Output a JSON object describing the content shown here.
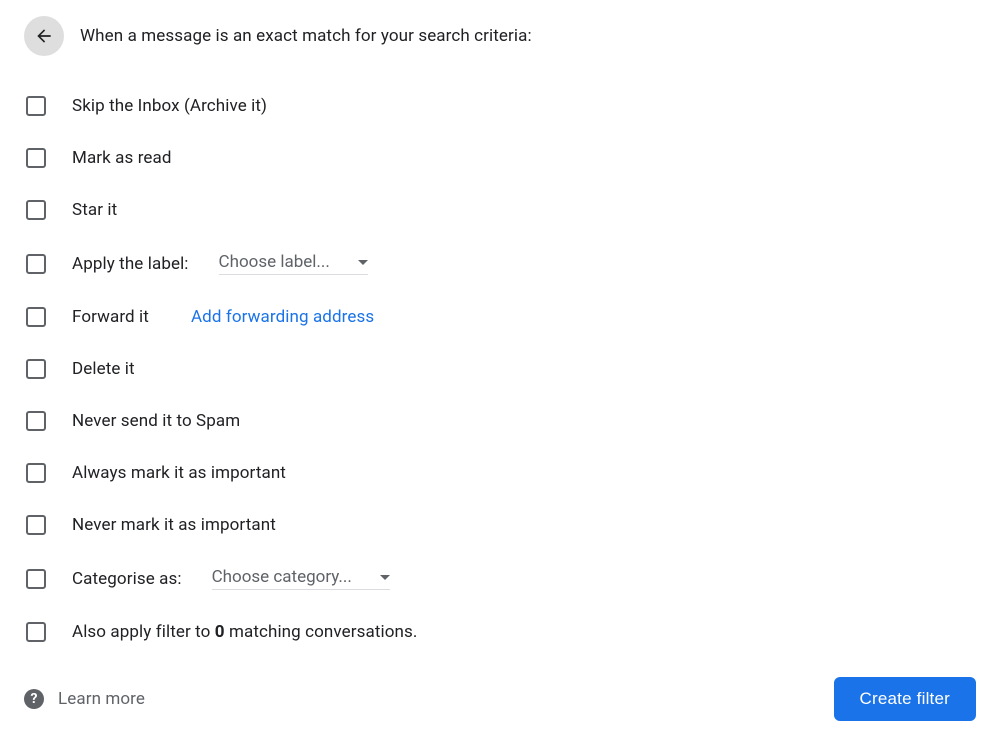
{
  "header": {
    "title": "When a message is an exact match for your search criteria:"
  },
  "options": {
    "skip_inbox": "Skip the Inbox (Archive it)",
    "mark_read": "Mark as read",
    "star_it": "Star it",
    "apply_label": "Apply the label:",
    "label_dropdown": "Choose label...",
    "forward_it": "Forward it",
    "forward_link": "Add forwarding address",
    "delete_it": "Delete it",
    "never_spam": "Never send it to Spam",
    "always_important": "Always mark it as important",
    "never_important": "Never mark it as important",
    "categorise_as": "Categorise as:",
    "category_dropdown": "Choose category...",
    "also_apply_before": "Also apply filter to ",
    "also_apply_count": "0",
    "also_apply_after": " matching conversations."
  },
  "footer": {
    "learn_more": "Learn more",
    "create_filter": "Create filter"
  }
}
